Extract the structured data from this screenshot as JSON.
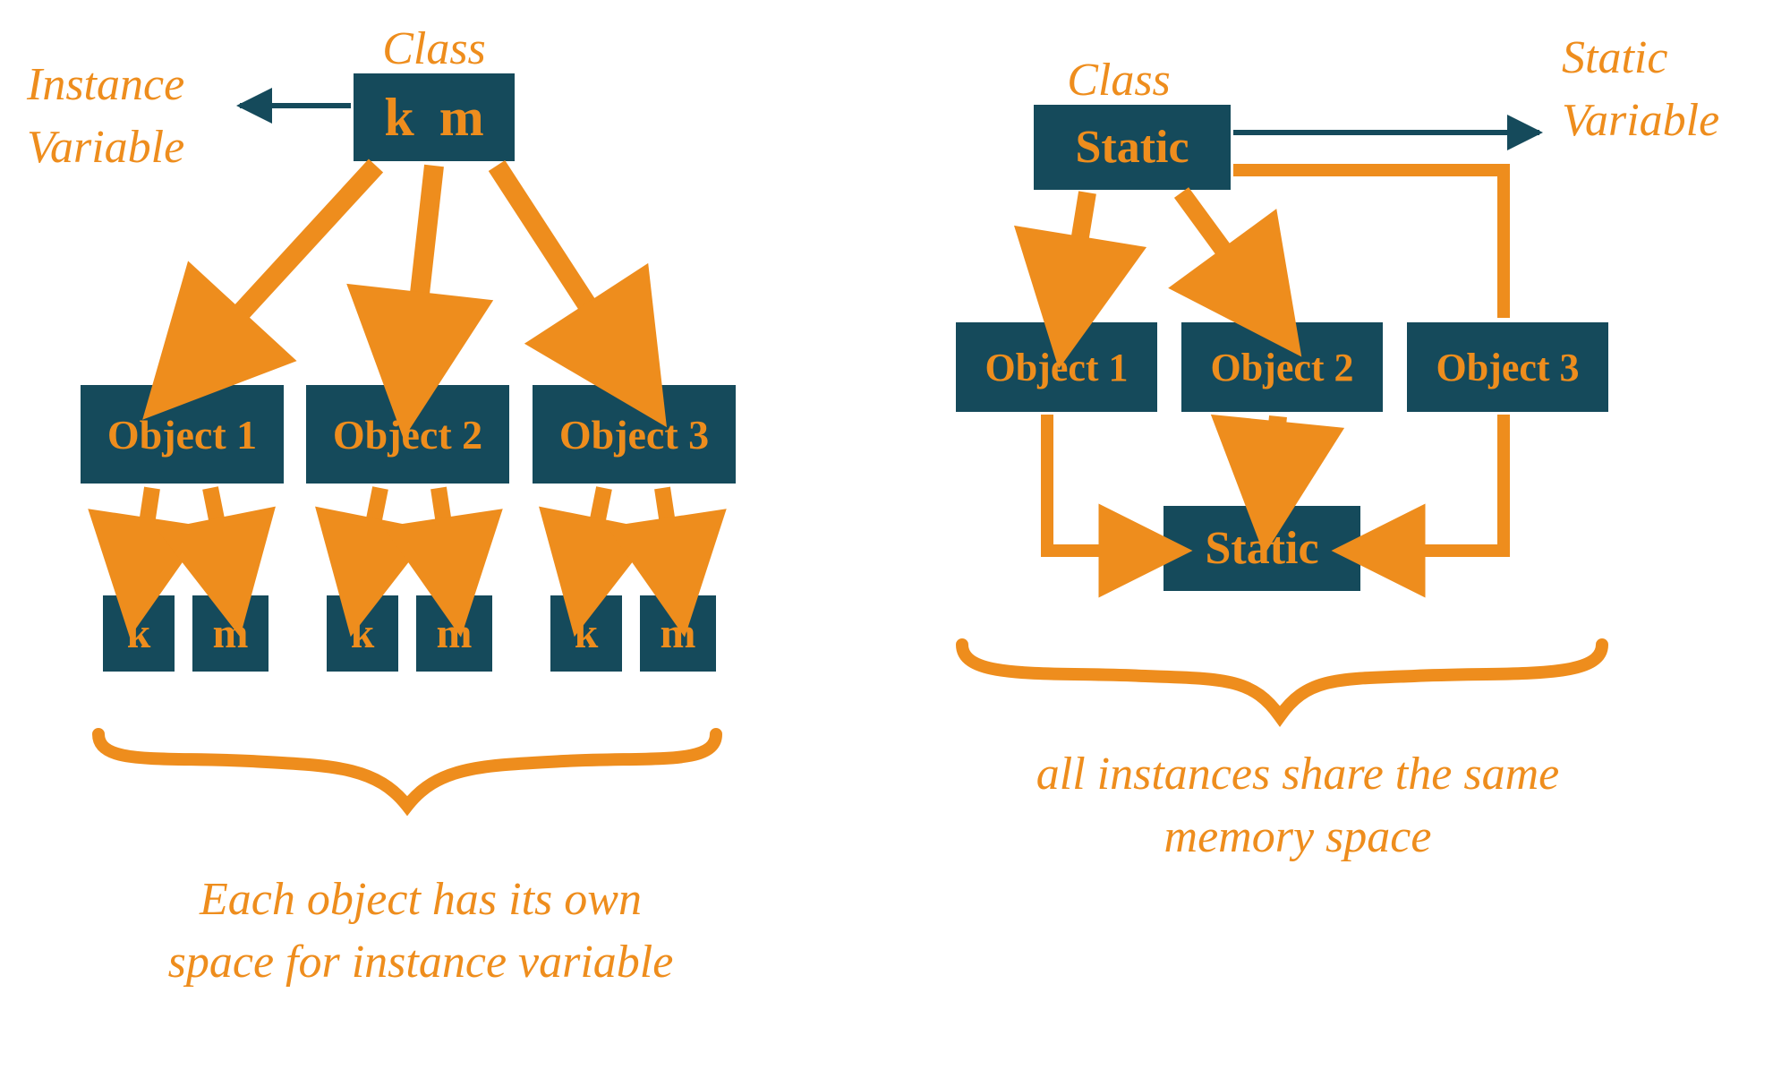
{
  "left": {
    "sideLabel": "Instance\nVariable",
    "classLabel": "Class",
    "classVars": {
      "k": "k",
      "m": "m"
    },
    "objects": [
      "Object 1",
      "Object 2",
      "Object 3"
    ],
    "varK": "k",
    "varM": "m",
    "caption": "Each object has its own\nspace for instance variable"
  },
  "right": {
    "sideLabel": "Static\nVariable",
    "classLabel": "Class",
    "classBox": "Static",
    "objects": [
      "Object 1",
      "Object 2",
      "Object 3"
    ],
    "sharedBox": "Static",
    "caption": "all instances share the same\nmemory space"
  },
  "colors": {
    "boxFill": "#154a5b",
    "orange": "#ee8d1d",
    "darkArrow": "#154a5b"
  }
}
